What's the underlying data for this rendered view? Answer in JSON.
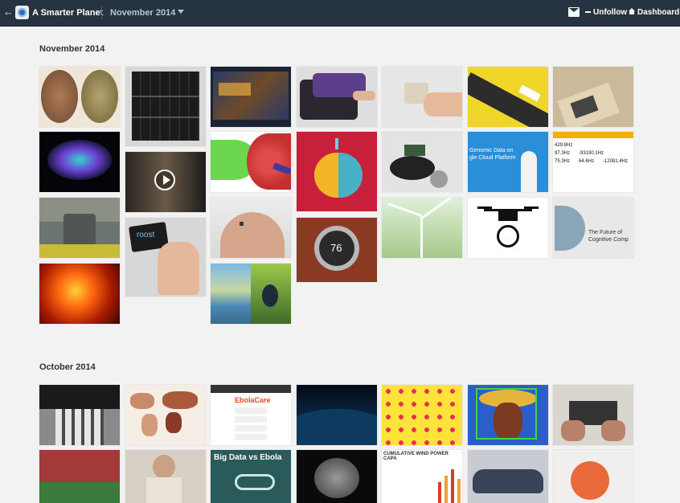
{
  "header": {
    "back_glyph": "←",
    "blog_title": "A Smarter Planet",
    "month_selector": "November 2014",
    "unfollow_label": "Unfollow",
    "dashboard_label": "Dashboard"
  },
  "sections": {
    "nov_title": "November 2014",
    "oct_title": "October 2014"
  },
  "thumb_text": {
    "roost": "roost",
    "nest_temp": "76",
    "genomic_line1": "Genomic Data on",
    "genomic_line2": "gle Cloud Platform",
    "table_val1": "429.8Hz",
    "table_val2": "97.3Hz",
    "table_val3": "-93190.1Hz",
    "table_val4": "75.3Hz",
    "table_val5": "64.6Hz",
    "table_val6": "-12081.4Hz",
    "cognitive_line1": "The Future of",
    "cognitive_line2": "Cognitive Comp",
    "ebola_title": "EbolaCare",
    "bigdata": "Big Data vs Ebola",
    "wind_chart": "CUMULATIVE WIND POWER CAPA"
  },
  "colors": {
    "topbar": "#263340",
    "page_bg": "#f2f2f2",
    "title_text": "#333333"
  }
}
